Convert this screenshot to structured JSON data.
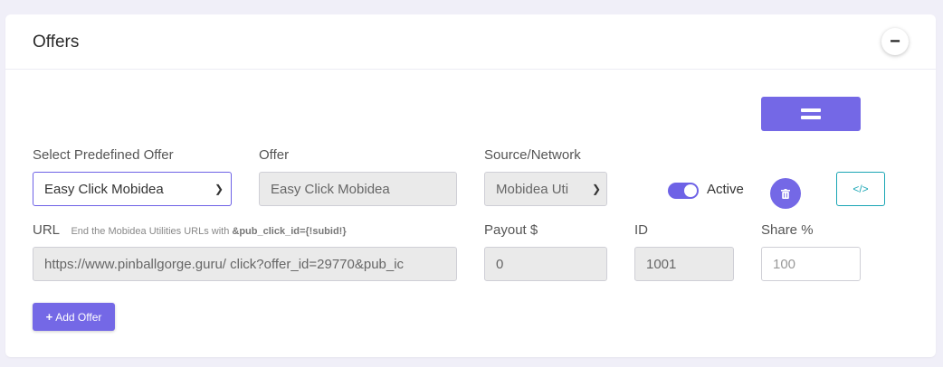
{
  "header": {
    "title": "Offers",
    "collapse_icon": "−"
  },
  "labels": {
    "predefined": "Select Predefined Offer",
    "offer": "Offer",
    "source": "Source/Network",
    "url": "URL",
    "url_hint_prefix": "End the Mobidea Utilities URLs with ",
    "url_hint_code": "&pub_click_id={!subid!}",
    "payout": "Payout $",
    "id": "ID",
    "share": "Share %",
    "active": "Active"
  },
  "fields": {
    "predefined_value": "Easy Click Mobidea",
    "offer_value": "Easy Click Mobidea",
    "source_value": "Mobidea Uti",
    "url_value": "https://www.pinballgorge.guru/ click?offer_id=29770&pub_ic",
    "payout_value": "0",
    "id_value": "1001",
    "share_placeholder": "100"
  },
  "toggle": {
    "active": true
  },
  "buttons": {
    "code_label": "</>",
    "add_label": "Add Offer",
    "add_icon": "+"
  },
  "colors": {
    "accent": "#7468e6",
    "teal": "#1ba6b5",
    "background": "#f0eff8"
  }
}
